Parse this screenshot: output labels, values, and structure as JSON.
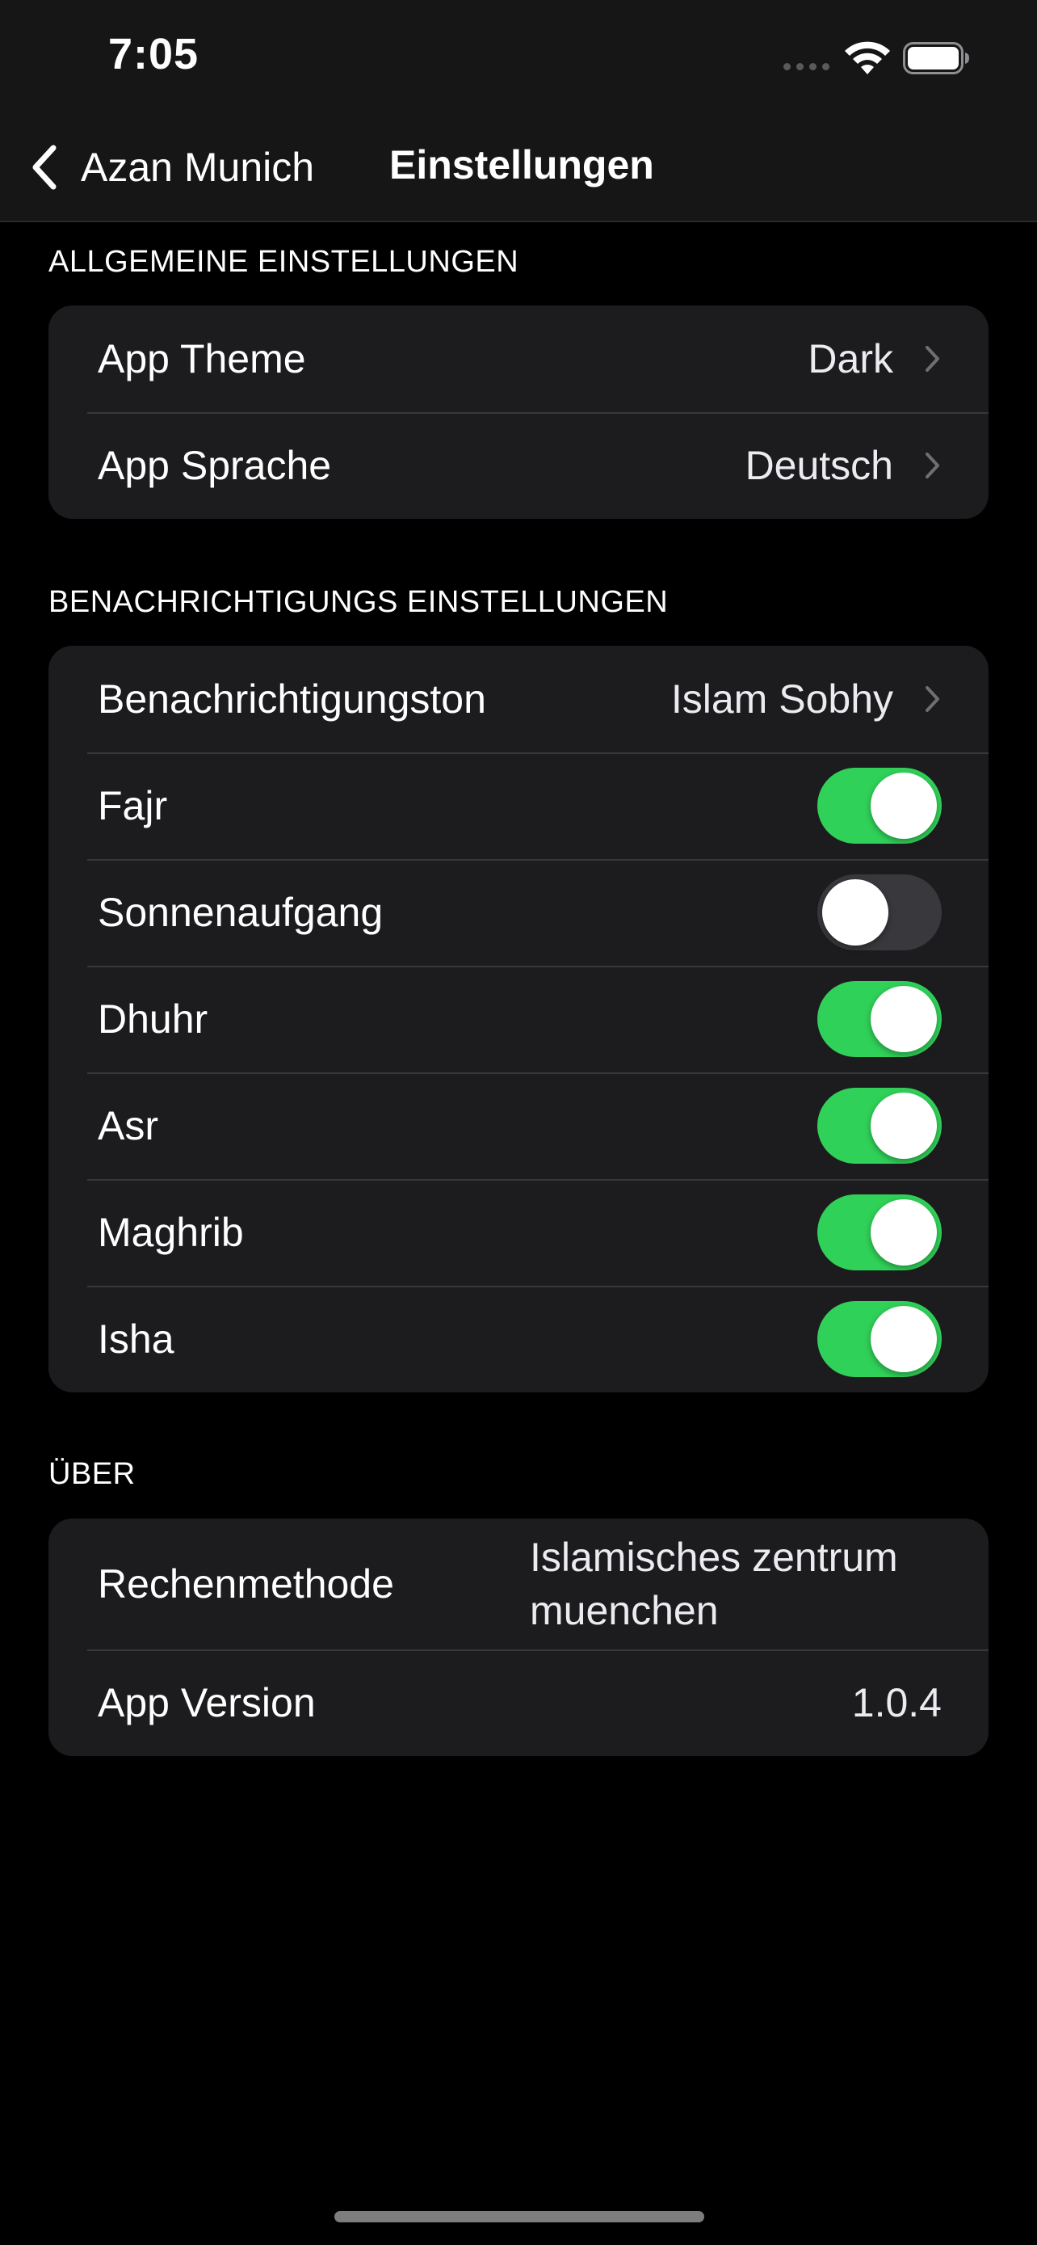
{
  "status_bar": {
    "time": "7:05"
  },
  "nav": {
    "back_label": "Azan Munich",
    "title": "Einstellungen"
  },
  "sections": {
    "general": {
      "header": "ALLGEMEINE EINSTELLUNGEN",
      "theme_label": "App Theme",
      "theme_value": "Dark",
      "language_label": "App Sprache",
      "language_value": "Deutsch"
    },
    "notifications": {
      "header": "BENACHRICHTIGUNGS EINSTELLUNGEN",
      "tone_label": "Benachrichtigungston",
      "tone_value": "Islam Sobhy",
      "prayers": [
        {
          "label": "Fajr",
          "enabled": true
        },
        {
          "label": "Sonnenaufgang",
          "enabled": false
        },
        {
          "label": "Dhuhr",
          "enabled": true
        },
        {
          "label": "Asr",
          "enabled": true
        },
        {
          "label": "Maghrib",
          "enabled": true
        },
        {
          "label": "Isha",
          "enabled": true
        }
      ]
    },
    "about": {
      "header": "ÜBER",
      "method_label": "Rechenmethode",
      "method_value": "Islamisches zentrum muenchen",
      "version_label": "App Version",
      "version_value": "1.0.4"
    }
  },
  "colors": {
    "background": "#000000",
    "group_background": "#1c1c1e",
    "toggle_on": "#30d158",
    "toggle_off": "#39393d",
    "separator": "#38383a"
  },
  "icons": [
    "back-chevron-icon",
    "chevron-right-icon",
    "wifi-icon",
    "battery-icon",
    "signal-icon"
  ]
}
